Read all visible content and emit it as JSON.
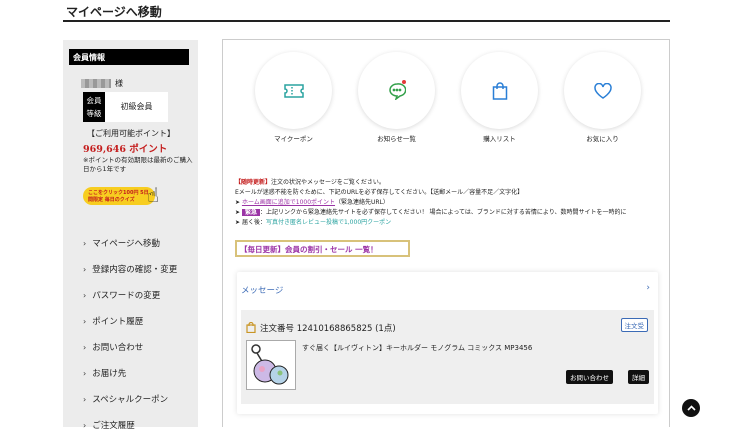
{
  "page": {
    "title": "マイページへ移動"
  },
  "sidebar": {
    "heading": "会員情報",
    "honorific": "様",
    "rank_label": "会員等級",
    "rank_value": "初級会員",
    "points_label": "【ご利用可能ポイント】",
    "points_value": "969,646 ポイント",
    "points_note": "※ポイントの有効期限は最新のご購入日から1年です",
    "campaign_text": "ここをクリック100円 5日間限定 毎日のクイズ",
    "menu": [
      "マイページへ移動",
      "登録内容の確認・変更",
      "パスワードの変更",
      "ポイント履歴",
      "お問い合わせ",
      "お届け先",
      "スペシャルクーポン",
      "ご注文履歴"
    ]
  },
  "quick_links": [
    {
      "label": "マイクーポン",
      "icon": "ticket-icon"
    },
    {
      "label": "お知らせ一覧",
      "icon": "chat-bubble-icon"
    },
    {
      "label": "購入リスト",
      "icon": "shopping-bag-icon"
    },
    {
      "label": "お気に入り",
      "icon": "heart-icon"
    }
  ],
  "notice": {
    "tag": "【随時更新】",
    "line1": "注文の状況やメッセージをご覧ください。",
    "line2": "Eメールが迷惑不能を防ぐために、下記のURLを必ず保存してください。【送郵メール／容量不足／文字化】",
    "line3_link": "ホーム画面に追加で1000ポイント",
    "line3_note": "（緊急連絡先URL）",
    "urgent_badge": "緊急",
    "line4": "：上記リンクから緊急連絡先サイトを必ず保存してください！ 場合によっては、ブランドに対する苦情により、数時間サイトを一時的に",
    "line5_prefix": "届く後：",
    "line5_link": "写真付き匿名レビュー投稿で1,000円クーポン"
  },
  "sale_banner": "【毎日更新】会員の割引・セール 一覧！",
  "messages": {
    "heading": "メッセージ",
    "order_number": "注文番号 12410168865825 (1点)",
    "order_status": "注文受",
    "product_name": "すぐ届く【ルイヴィトン】キーホルダー モノグラム コミックス MP3456",
    "contact_button": "お問い合わせ",
    "detail_button": "詳細"
  },
  "colors": {
    "accent_red": "#c41d1d",
    "accent_purple": "#9b34a6",
    "link_blue": "#3c6bb6",
    "campaign_yellow": "#f7cd20"
  }
}
